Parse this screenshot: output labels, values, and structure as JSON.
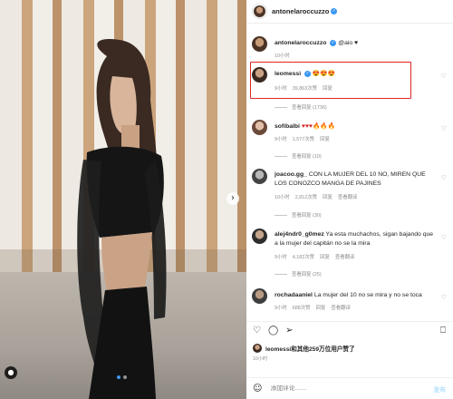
{
  "post": {
    "author": "antonelaroccuzzo",
    "caption_user": "antonelaroccuzzo",
    "caption_text": "@aio ♥",
    "caption_time": "10小时"
  },
  "comments": [
    {
      "user": "leomessi",
      "text": "😍😍😍",
      "time": "9小时",
      "likes": "39,863次赞",
      "reply": "回复",
      "replies": "查看回复 (1736)"
    },
    {
      "user": "sofibalbi",
      "text": "♥♥♥🔥🔥🔥",
      "time": "9小时",
      "likes": "1,577次赞",
      "reply": "回复",
      "replies": "查看回复 (10)"
    },
    {
      "user": "joacoo.gg_",
      "text": "CON LA MUJER DEL 10 NO, MIREN QUE LOS CONOZCO MANGA DE PAJINES",
      "time": "10小时",
      "likes": "2,812次赞",
      "reply": "回复",
      "translate": "查看翻译",
      "replies": "查看回复 (30)"
    },
    {
      "user": "alej4ndr0_g0mez",
      "text": "Ya esta muchachos, sigan bajando que a la mujer del capitán no se la mira",
      "time": "9小时",
      "likes": "4,182次赞",
      "reply": "回复",
      "translate": "查看翻译",
      "replies": "查看回复 (25)"
    },
    {
      "user": "rochadaaniel",
      "text": "La mujer del 10 no se mira y no se toca",
      "time": "9小时",
      "likes": "688次赞",
      "reply": "回复",
      "translate": "查看翻译"
    }
  ],
  "likes_text": "leomessi和其他259万位用户赞了",
  "time_bottom": "10小时",
  "add_comment_placeholder": "添加评论……",
  "post_button": "发布",
  "icons": {
    "like": "heart-icon",
    "comment": "comment-icon",
    "share": "share-icon",
    "save": "bookmark-icon",
    "emoji": "smile-icon",
    "next": "chevron-right-icon",
    "tag": "user-tag-icon"
  },
  "colors": {
    "verified": "#3897f0",
    "highlight": "#e02424",
    "muted": "#8e8e8e"
  }
}
